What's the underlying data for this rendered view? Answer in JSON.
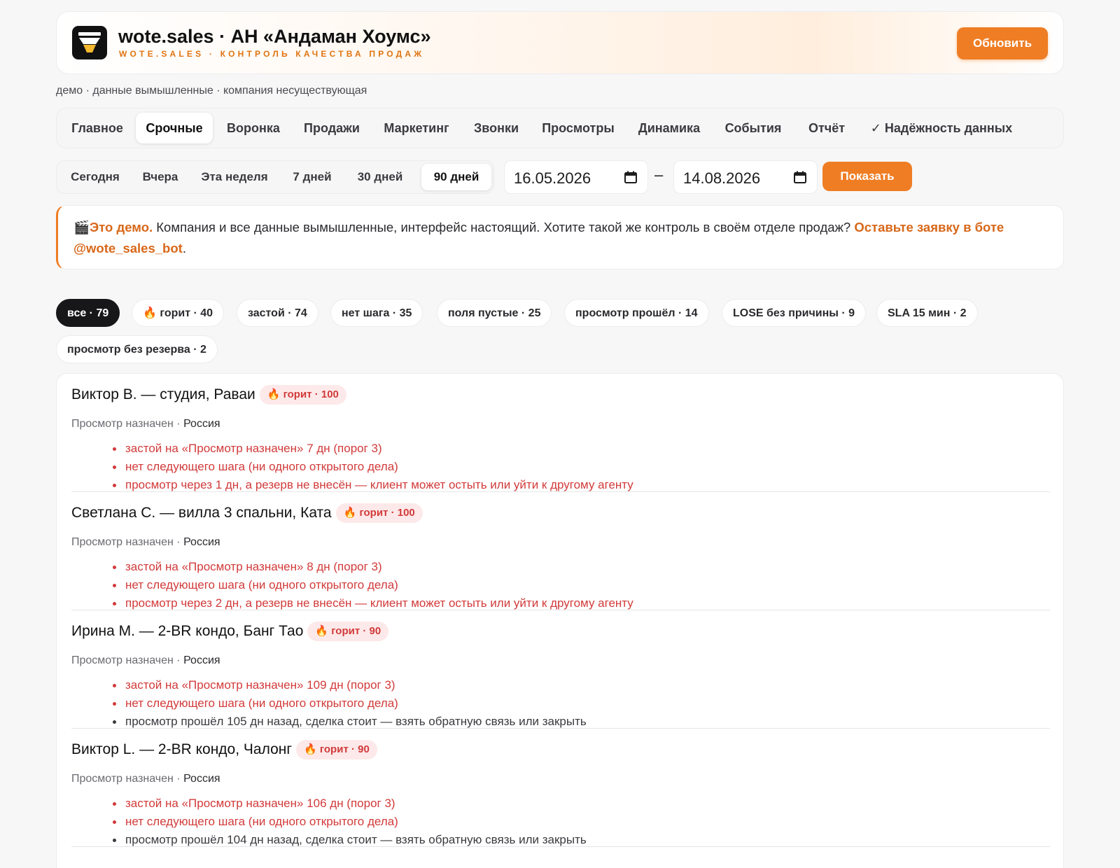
{
  "header": {
    "title": "wote.sales · АН «Андаман Хоумс»",
    "subtitle": "WOTE.SALES · КОНТРОЛЬ КАЧЕСТВА ПРОДАЖ",
    "refresh_label": "Обновить"
  },
  "demo_note": "демо · данные вымышленные · компания несуществующая",
  "tabs": [
    {
      "label": "Главное"
    },
    {
      "label": "Срочные",
      "active": true
    },
    {
      "label": "Воронка"
    },
    {
      "label": "Продажи"
    },
    {
      "label": "Маркетинг"
    },
    {
      "label": "Звонки"
    },
    {
      "label": "Просмотры"
    },
    {
      "label": "Динамика"
    },
    {
      "label": "События"
    },
    {
      "label": "Отчёт"
    },
    {
      "label": "✓ Надёжность данных"
    }
  ],
  "periods": [
    {
      "label": "Сегодня"
    },
    {
      "label": "Вчера"
    },
    {
      "label": "Эта неделя"
    },
    {
      "label": "7 дней"
    },
    {
      "label": "30 дней"
    },
    {
      "label": "90 дней",
      "active": true
    }
  ],
  "date_from": "16.05.2026",
  "date_to": "14.08.2026",
  "date_separator": "–",
  "show_label": "Показать",
  "banner": {
    "emoji": "🎬",
    "lead": "Это демо.",
    "text": " Компания и все данные вымышленные, интерфейс настоящий. Хотите такой же контроль в своём отделе продаж? ",
    "cta": "Оставьте заявку в боте @wote_sales_bot",
    "end": "."
  },
  "filters": [
    {
      "label": "все",
      "count": "79",
      "active": true
    },
    {
      "label": "🔥 горит",
      "count": "40"
    },
    {
      "label": "застой",
      "count": "74"
    },
    {
      "label": "нет шага",
      "count": "35"
    },
    {
      "label": "поля пустые",
      "count": "25"
    },
    {
      "label": "просмотр прошёл",
      "count": "14"
    },
    {
      "label": "LOSE без причины",
      "count": "9"
    },
    {
      "label": "SLA 15 мин",
      "count": "2"
    },
    {
      "label": "просмотр без резерва",
      "count": "2"
    }
  ],
  "deals": [
    {
      "title": "Виктор В. — студия, Раваи",
      "badge": "🔥 горит · 100",
      "stage": "Просмотр назначен",
      "country": "Россия",
      "issues": [
        {
          "text": "застой на «Просмотр назначен» 7 дн (порог 3)",
          "tone": "red"
        },
        {
          "text": "нет следующего шага (ни одного открытого дела)",
          "tone": "red"
        },
        {
          "text": "просмотр через 1 дн, а резерв не внесён — клиент может остыть или уйти к другому агенту",
          "tone": "red"
        }
      ]
    },
    {
      "title": "Светлана С. — вилла 3 спальни, Ката",
      "badge": "🔥 горит · 100",
      "stage": "Просмотр назначен",
      "country": "Россия",
      "issues": [
        {
          "text": "застой на «Просмотр назначен» 8 дн (порог 3)",
          "tone": "red"
        },
        {
          "text": "нет следующего шага (ни одного открытого дела)",
          "tone": "red"
        },
        {
          "text": "просмотр через 2 дн, а резерв не внесён — клиент может остыть или уйти к другому агенту",
          "tone": "red"
        }
      ]
    },
    {
      "title": "Ирина М. — 2-BR кондо, Банг Тао",
      "badge": "🔥 горит · 90",
      "stage": "Просмотр назначен",
      "country": "Россия",
      "issues": [
        {
          "text": "застой на «Просмотр назначен» 109 дн (порог 3)",
          "tone": "red"
        },
        {
          "text": "нет следующего шага (ни одного открытого дела)",
          "tone": "red"
        },
        {
          "text": "просмотр прошёл 105 дн назад, сделка стоит — взять обратную связь или закрыть",
          "tone": "gray"
        }
      ]
    },
    {
      "title": "Виктор L. — 2-BR кондо, Чалонг",
      "badge": "🔥 горит · 90",
      "stage": "Просмотр назначен",
      "country": "Россия",
      "issues": [
        {
          "text": "застой на «Просмотр назначен» 106 дн (порог 3)",
          "tone": "red"
        },
        {
          "text": "нет следующего шага (ни одного открытого дела)",
          "tone": "red"
        },
        {
          "text": "просмотр прошёл 104 дн назад, сделка стоит — взять обратную связь или закрыть",
          "tone": "gray"
        }
      ]
    }
  ],
  "colors": {
    "accent": "#ef7d24",
    "danger": "#d23a3a",
    "badge_bg": "#fde9e9",
    "chip_active": "#17171a"
  },
  "icons": {
    "logo": "funnel-logo-icon",
    "calendar": "calendar-icon"
  }
}
